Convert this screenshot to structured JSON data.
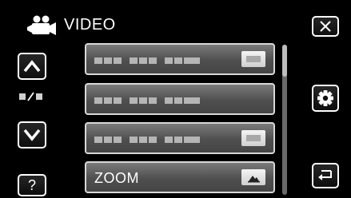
{
  "header": {
    "title": "VIDEO",
    "mode_icon": "video-camera-icon"
  },
  "nav": {
    "up_icon": "chevron-up-icon",
    "down_icon": "chevron-down-icon",
    "page_indicator_icon": "page-indicator-icon",
    "help_label": "?"
  },
  "right": {
    "close_icon": "close-icon",
    "settings_icon": "gear-icon",
    "back_icon": "return-icon"
  },
  "menu": {
    "items": [
      {
        "label": "",
        "value_icon": "setting-value-icon"
      },
      {
        "label": "",
        "value_icon": "setting-value-icon"
      },
      {
        "label": "",
        "value_icon": "setting-value-icon"
      },
      {
        "label": "ZOOM",
        "value_icon": "zoom-mountain-icon"
      }
    ]
  },
  "colors": {
    "background": "#000000",
    "item_gray": "#5a5a5a",
    "border": "#ffffff"
  }
}
